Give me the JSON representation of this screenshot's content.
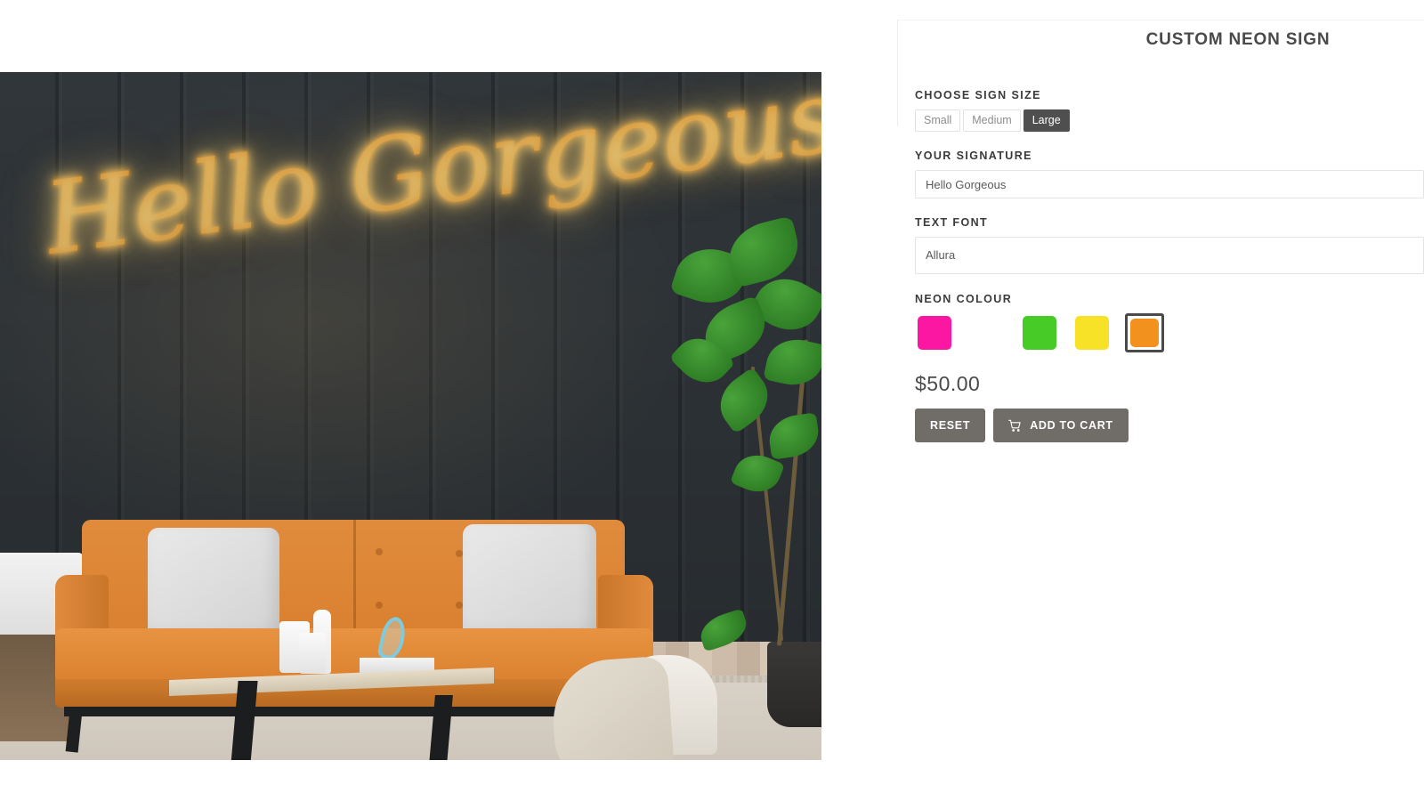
{
  "panel": {
    "title": "CUSTOM NEON SIGN"
  },
  "size": {
    "label": "CHOOSE SIGN SIZE",
    "options": [
      {
        "label": "Small",
        "selected": false
      },
      {
        "label": "Medium",
        "selected": false
      },
      {
        "label": "Large",
        "selected": true
      }
    ]
  },
  "signature": {
    "label": "YOUR SIGNATURE",
    "value": "Hello Gorgeous",
    "placeholder": "Hello Gorgeous"
  },
  "font": {
    "label": "TEXT FONT",
    "value": "Allura"
  },
  "colour": {
    "label": "NEON COLOUR",
    "swatches": [
      {
        "name": "pink",
        "hex": "#FC17A2",
        "selected": false
      },
      {
        "name": "white",
        "hex": "#FFFFFF",
        "selected": false
      },
      {
        "name": "green",
        "hex": "#47CB26",
        "selected": false
      },
      {
        "name": "yellow",
        "hex": "#F7E228",
        "selected": false
      },
      {
        "name": "orange",
        "hex": "#F2911E",
        "selected": true
      }
    ]
  },
  "price": "$50.00",
  "actions": {
    "reset_label": "RESET",
    "cart_label": "ADD TO CART",
    "cart_icon": "shopping-cart-icon"
  },
  "preview": {
    "sign_text": "Hello Gorgeous",
    "sign_colour": "#F2911E",
    "sign_glow": "#FFE08A",
    "scene": "living-room-dark-panel-wall-orange-sofa"
  }
}
